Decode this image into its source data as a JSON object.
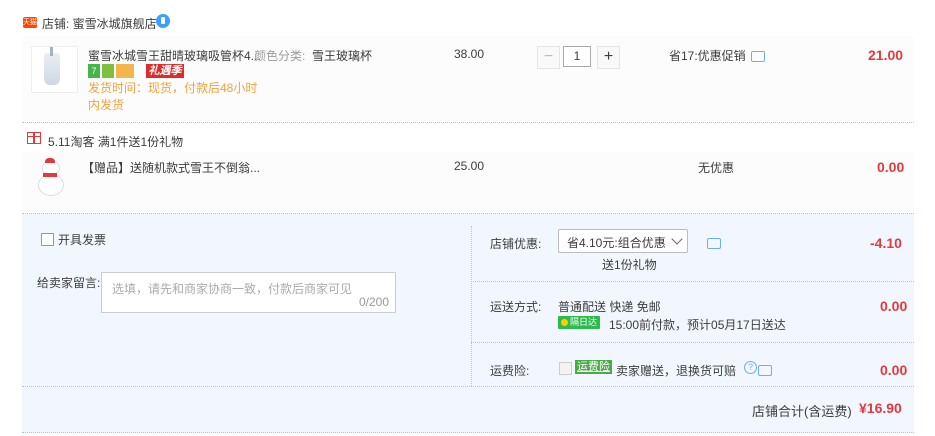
{
  "store": {
    "tag": "天猫",
    "name": "店铺: 蜜雪冰城旗舰店"
  },
  "item1": {
    "title": "蜜雪冰城雪王甜晴玻璃吸管杯4...",
    "sku_label": "颜色分类:",
    "sku_value": "雪王玻璃杯",
    "badges": [
      "7",
      "",
      "",
      "礼遇季"
    ],
    "ship_time": "发货时间：现货，付款后48小时内发货",
    "unit_price": "38.00",
    "quantity": "1",
    "promo": "省17:优惠促销",
    "total": "21.00"
  },
  "gift_promo": {
    "text": "5.11淘客    满1件送1份礼物"
  },
  "item2": {
    "title": "【赠品】送随机款式雪王不倒翁...",
    "unit_price": "25.00",
    "promo": "无优惠",
    "total": "0.00"
  },
  "invoice": {
    "label": "开具发票"
  },
  "message": {
    "label": "给卖家留言:",
    "placeholder": "选填，请先和商家协商一致，付款后商家可见",
    "count": "0/200"
  },
  "shop_discount": {
    "label": "店铺优惠:",
    "selected": "省4.10元:组合优惠",
    "sub": "送1份礼物",
    "value": "-4.10"
  },
  "shipping": {
    "label": "运送方式:",
    "method": "普通配送 快递 免邮",
    "badge": "隔日达",
    "time": "15:00前付款，预计05月17日送达",
    "value": "0.00"
  },
  "insurance": {
    "label": "运费险:",
    "badge": "运费险",
    "text": "卖家赠送，退换货可赔",
    "value": "0.00"
  },
  "summary": {
    "label": "店铺合计(含运费)",
    "value": "¥16.90"
  },
  "colors": {
    "price_red": "#e4393c",
    "accent_blue": "#3ba0ff",
    "panel_bg": "#f2f7ff",
    "ship_orange": "#f3a23a",
    "green": "#2dbb4e"
  }
}
